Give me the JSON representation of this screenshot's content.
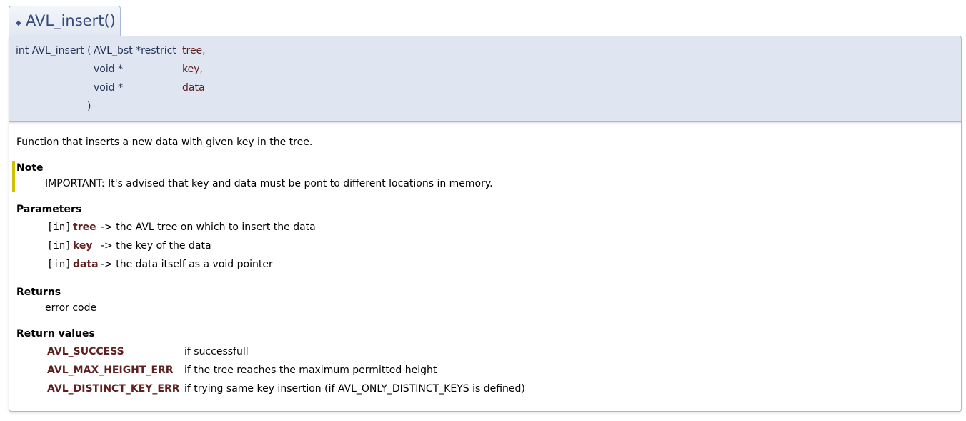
{
  "title": "AVL_insert()",
  "prototype": {
    "return_and_name": "int AVL_insert (",
    "params": [
      {
        "type": "AVL_bst *restrict",
        "name": "tree,"
      },
      {
        "type": "void *",
        "name": "key,"
      },
      {
        "type": "void *",
        "name": "data"
      }
    ],
    "close": ")"
  },
  "description": "Function that inserts a new data with given key in the tree.",
  "note": {
    "heading": "Note",
    "text": "IMPORTANT: It's advised that key and data must be pont to different locations in memory."
  },
  "parameters": {
    "heading": "Parameters",
    "items": [
      {
        "dir": "[in]",
        "name": "tree",
        "desc": "-> the AVL tree on which to insert the data"
      },
      {
        "dir": "[in]",
        "name": "key",
        "desc": "-> the key of the data"
      },
      {
        "dir": "[in]",
        "name": "data",
        "desc": "-> the data itself as a void pointer"
      }
    ]
  },
  "returns": {
    "heading": "Returns",
    "text": "error code"
  },
  "return_values": {
    "heading": "Return values",
    "items": [
      {
        "name": "AVL_SUCCESS",
        "desc": "if successfull"
      },
      {
        "name": "AVL_MAX_HEIGHT_ERR",
        "desc": "if the tree reaches the maximum permitted height"
      },
      {
        "name": "AVL_DISTINCT_KEY_ERR",
        "desc": "if trying same key insertion (if AVL_ONLY_DISTINCT_KEYS is defined)"
      }
    ]
  },
  "colors": {
    "accent": "#354c7b",
    "param_name": "#602020",
    "note_bar": "#d0c000",
    "proto_bg": "#dfe5f1"
  }
}
